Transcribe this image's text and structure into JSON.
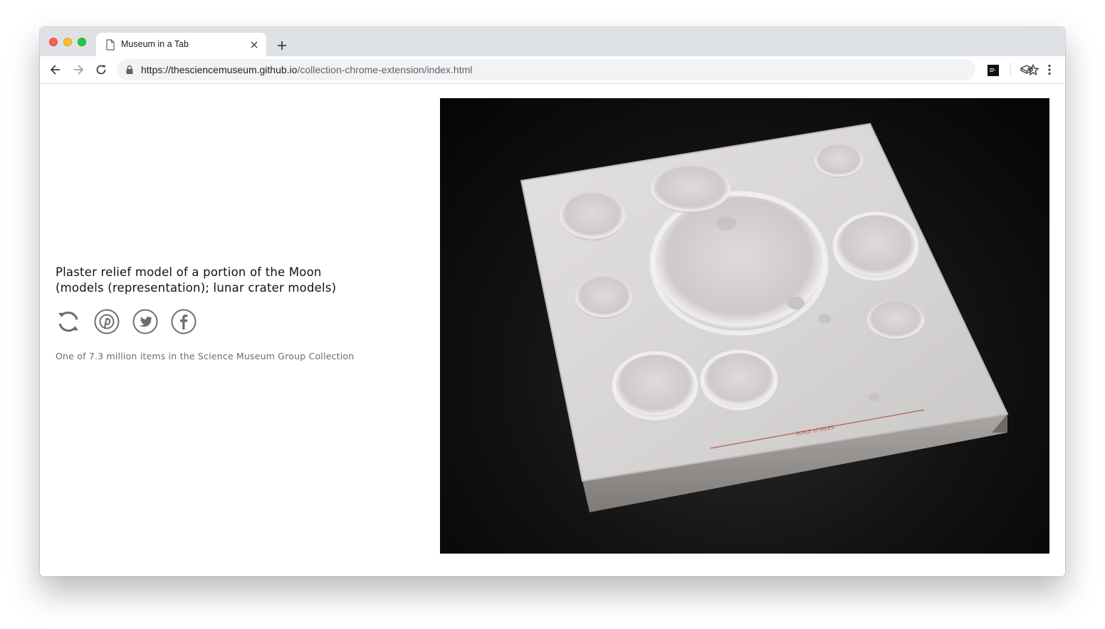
{
  "browser": {
    "tab": {
      "title": "Museum in a Tab",
      "icon": "document-icon"
    },
    "url": {
      "host": "https://thesciencemuseum.github.io",
      "path": "/collection-chrome-extension/index.html"
    }
  },
  "page": {
    "title": "Plaster relief model of a portion of the Moon (models (representation); lunar crater models)",
    "caption": "One of 7.3 million items in the Science Museum Group Collection",
    "share_icons": [
      "refresh-icon",
      "pinterest-icon",
      "twitter-icon",
      "facebook-icon"
    ],
    "image": {
      "subject": "plaster lunar crater relief model",
      "scale_text": "SCALE of MILES"
    }
  },
  "colors": {
    "icon_gray": "#6e6e6e",
    "photo_bg": "#0d0d0d",
    "plaster": "#d9d6d6"
  }
}
